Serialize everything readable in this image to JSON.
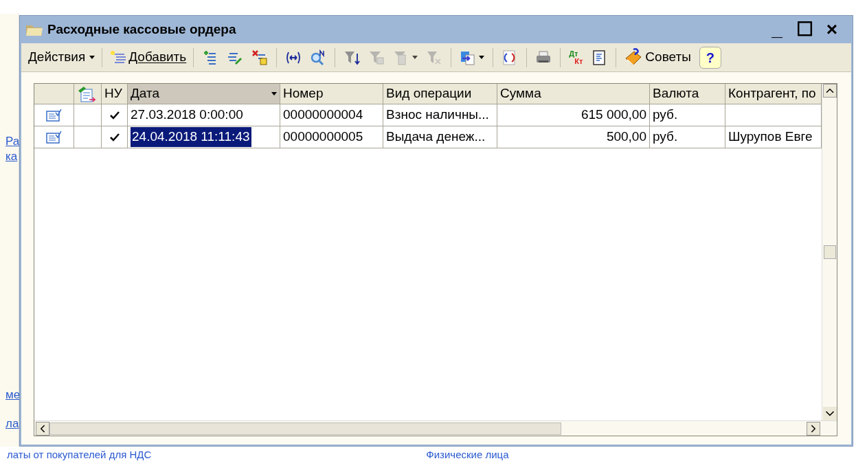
{
  "background": {
    "side_links": [
      "Ра",
      "ка",
      "ме",
      "ла"
    ],
    "bottom_links": [
      "латы от покупателей для НДС",
      "Физические лица"
    ]
  },
  "window": {
    "title": "Расходные кассовые ордера",
    "controls": [
      "_",
      "☐",
      "×"
    ]
  },
  "toolbar": [
    {
      "kind": "menu",
      "label": "Действия"
    },
    {
      "kind": "sep"
    },
    {
      "kind": "labeled",
      "label": "Добавить",
      "disabled": false
    },
    {
      "kind": "sep"
    },
    {
      "kind": "icon",
      "disabled": false
    },
    {
      "kind": "icon",
      "disabled": false
    },
    {
      "kind": "icon",
      "disabled": false
    },
    {
      "kind": "sep"
    },
    {
      "kind": "icon",
      "disabled": false
    },
    {
      "kind": "icon",
      "disabled": false
    },
    {
      "kind": "sep"
    },
    {
      "kind": "icon",
      "disabled": false
    },
    {
      "kind": "icon",
      "disabled": true
    },
    {
      "kind": "icon",
      "disabled": true,
      "dropdown": true
    },
    {
      "kind": "icon",
      "disabled": true
    },
    {
      "kind": "sep"
    },
    {
      "kind": "icon",
      "disabled": false,
      "dropdown": true
    },
    {
      "kind": "sep"
    },
    {
      "kind": "icon",
      "disabled": false
    },
    {
      "kind": "sep"
    },
    {
      "kind": "icon",
      "disabled": false
    },
    {
      "kind": "sep"
    },
    {
      "kind": "dtkt",
      "top": "Дт",
      "bottom": "Кт"
    },
    {
      "kind": "icon",
      "disabled": false
    },
    {
      "kind": "sep"
    },
    {
      "kind": "labeled",
      "label": "Советы",
      "disabled": false
    },
    {
      "kind": "help",
      "label": "?"
    }
  ],
  "table": {
    "columns": [
      {},
      {},
      {
        "label": "НУ"
      },
      {
        "label": "Дата",
        "sorted": true
      },
      {
        "label": "Номер"
      },
      {
        "label": "Вид операции"
      },
      {
        "label": "Сумма"
      },
      {
        "label": "Валюта"
      },
      {
        "label": "Контрагент, по"
      }
    ],
    "rows": [
      {
        "nu": true,
        "date": "27.03.2018 0:00:00",
        "number": "00000000004",
        "operation": "Взнос наличны...",
        "sum": "615 000,00",
        "currency": "руб.",
        "selected": false
      },
      {
        "nu": true,
        "date": "24.04.2018 11:11:43",
        "number": "00000000005",
        "operation": "Выдача денеж...",
        "sum": "500,00",
        "currency": "руб.",
        "counterparty": "Шурупов Евге",
        "selected": true
      }
    ]
  }
}
